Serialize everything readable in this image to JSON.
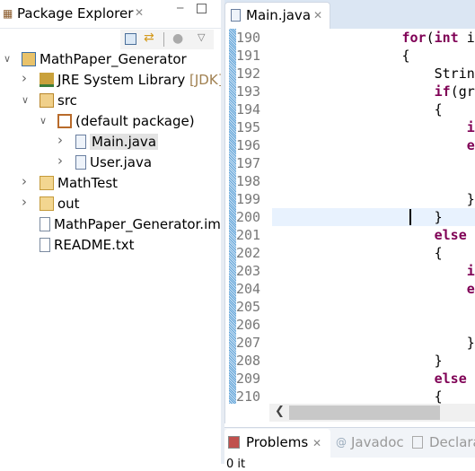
{
  "package_explorer": {
    "title": "Package Explorer",
    "tree": [
      {
        "label": "MathPaper_Generator",
        "icon": "project-folder-icon",
        "expanded": true
      },
      {
        "label": "JRE System Library",
        "suffix": "[JDK]",
        "icon": "library-icon",
        "expanded": false
      },
      {
        "label": "src",
        "icon": "source-folder-icon",
        "expanded": true
      },
      {
        "label": "(default package)",
        "icon": "package-icon",
        "expanded": true
      },
      {
        "label": "Main.java",
        "icon": "java-file-icon",
        "expanded": false,
        "selected": true
      },
      {
        "label": "User.java",
        "icon": "java-file-icon",
        "expanded": false
      },
      {
        "label": "MathTest",
        "icon": "folder-icon",
        "expanded": false
      },
      {
        "label": "out",
        "icon": "folder-icon",
        "expanded": false
      },
      {
        "label": "MathPaper_Generator.im",
        "icon": "text-file-icon"
      },
      {
        "label": "README.txt",
        "icon": "text-file-icon"
      }
    ]
  },
  "editor": {
    "tab_label": "Main.java",
    "current_line": 200,
    "lines": [
      {
        "num": "190",
        "tokens": [
          [
            "                ",
            0
          ],
          [
            "for",
            1
          ],
          [
            "(",
            0
          ],
          [
            "int",
            1
          ],
          [
            " i",
            0
          ]
        ]
      },
      {
        "num": "191",
        "tokens": [
          [
            "                {",
            0
          ]
        ]
      },
      {
        "num": "192",
        "tokens": [
          [
            "                    Strin",
            0
          ]
        ]
      },
      {
        "num": "193",
        "tokens": [
          [
            "                    ",
            0
          ],
          [
            "if",
            1
          ],
          [
            "(gr",
            0
          ]
        ]
      },
      {
        "num": "194",
        "tokens": [
          [
            "                    {",
            0
          ]
        ]
      },
      {
        "num": "195",
        "tokens": [
          [
            "                        ",
            0
          ],
          [
            "i",
            1
          ]
        ]
      },
      {
        "num": "196",
        "tokens": [
          [
            "                        ",
            0
          ],
          [
            "e",
            1
          ]
        ]
      },
      {
        "num": "197",
        "tokens": []
      },
      {
        "num": "198",
        "tokens": []
      },
      {
        "num": "199",
        "tokens": [
          [
            "                        }",
            0
          ]
        ]
      },
      {
        "num": "200",
        "tokens": [
          [
            "                    }",
            0
          ]
        ]
      },
      {
        "num": "201",
        "tokens": [
          [
            "                    ",
            0
          ],
          [
            "else",
            1
          ]
        ]
      },
      {
        "num": "202",
        "tokens": [
          [
            "                    {",
            0
          ]
        ]
      },
      {
        "num": "203",
        "tokens": [
          [
            "                        ",
            0
          ],
          [
            "i",
            1
          ]
        ]
      },
      {
        "num": "204",
        "tokens": [
          [
            "                        ",
            0
          ],
          [
            "e",
            1
          ]
        ]
      },
      {
        "num": "205",
        "tokens": []
      },
      {
        "num": "206",
        "tokens": []
      },
      {
        "num": "207",
        "tokens": [
          [
            "                        }",
            0
          ]
        ]
      },
      {
        "num": "208",
        "tokens": [
          [
            "                    }",
            0
          ]
        ]
      },
      {
        "num": "209",
        "tokens": [
          [
            "                    ",
            0
          ],
          [
            "else",
            1
          ]
        ]
      },
      {
        "num": "210",
        "tokens": [
          [
            "                    {",
            0
          ]
        ]
      }
    ]
  },
  "bottom_panel": {
    "tabs": [
      {
        "label": "Problems",
        "active": true
      },
      {
        "label": "Javadoc"
      },
      {
        "label": "Declara"
      }
    ],
    "status": "0 it"
  },
  "colors": {
    "keyword": "#7f0055",
    "current_line": "#e8f2fe",
    "tab_bar": "#dbe6f3"
  }
}
